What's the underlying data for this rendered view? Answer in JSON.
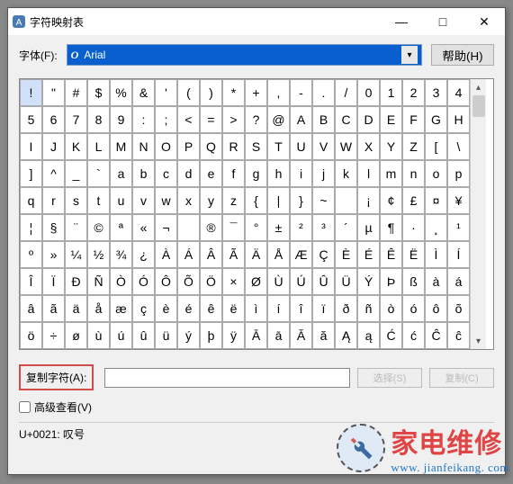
{
  "window": {
    "title": "字符映射表",
    "minimize": "—",
    "maximize": "□",
    "close": "✕"
  },
  "font": {
    "label": "字体(F):",
    "selected": "Arial",
    "icon": "O",
    "arrow": "▾"
  },
  "help": {
    "label": "帮助(H)"
  },
  "grid": {
    "chars": [
      "!",
      "\"",
      "#",
      "$",
      "%",
      "&",
      "'",
      "(",
      ")",
      "*",
      "+",
      ",",
      "-",
      ".",
      "/",
      "0",
      "1",
      "2",
      "3",
      "4",
      "5",
      "6",
      "7",
      "8",
      "9",
      ":",
      ";",
      "<",
      "=",
      ">",
      "?",
      "@",
      "A",
      "B",
      "C",
      "D",
      "E",
      "F",
      "G",
      "H",
      "I",
      "J",
      "K",
      "L",
      "M",
      "N",
      "O",
      "P",
      "Q",
      "R",
      "S",
      "T",
      "U",
      "V",
      "W",
      "X",
      "Y",
      "Z",
      "[",
      "\\",
      "]",
      "^",
      "_",
      "`",
      "a",
      "b",
      "c",
      "d",
      "e",
      "f",
      "g",
      "h",
      "i",
      "j",
      "k",
      "l",
      "m",
      "n",
      "o",
      "p",
      "q",
      "r",
      "s",
      "t",
      "u",
      "v",
      "w",
      "x",
      "y",
      "z",
      "{",
      "|",
      "}",
      "~",
      " ",
      "¡",
      "¢",
      "£",
      "¤",
      "¥",
      "¦",
      "§",
      "¨",
      "©",
      "ª",
      "«",
      "¬",
      "­",
      "®",
      "¯",
      "°",
      "±",
      "²",
      "³",
      "´",
      "µ",
      "¶",
      "·",
      "¸",
      "¹",
      "º",
      "»",
      "¼",
      "½",
      "¾",
      "¿",
      "À",
      "Á",
      "Â",
      "Ã",
      "Ä",
      "Å",
      "Æ",
      "Ç",
      "È",
      "É",
      "Ê",
      "Ë",
      "Ì",
      "Í",
      "Î",
      "Ï",
      "Ð",
      "Ñ",
      "Ò",
      "Ó",
      "Ô",
      "Õ",
      "Ö",
      "×",
      "Ø",
      "Ù",
      "Ú",
      "Û",
      "Ü",
      "Ý",
      "Þ",
      "ß",
      "à",
      "á",
      "â",
      "ã",
      "ä",
      "å",
      "æ",
      "ç",
      "è",
      "é",
      "ê",
      "ë",
      "ì",
      "í",
      "î",
      "ï",
      "ð",
      "ñ",
      "ò",
      "ó",
      "ô",
      "õ",
      "ö",
      "÷",
      "ø",
      "ù",
      "ú",
      "û",
      "ü",
      "ý",
      "þ",
      "ÿ",
      "Ā",
      "ā",
      "Ă",
      "ă",
      "Ą",
      "ą",
      "Ć",
      "ć",
      "Ĉ",
      "ĉ"
    ],
    "selected_index": 0,
    "scroll_up": "▴",
    "scroll_down": "▾"
  },
  "copy": {
    "label": "复制字符(A):",
    "value": "",
    "select_btn": "选择(S)",
    "copy_btn": "复制(C)"
  },
  "advanced": {
    "label": "高级查看(V)",
    "checked": false
  },
  "status": {
    "text": "U+0021: 叹号"
  },
  "watermark": {
    "cn": "家电维修",
    "en": "www. jianfeikang. com"
  }
}
